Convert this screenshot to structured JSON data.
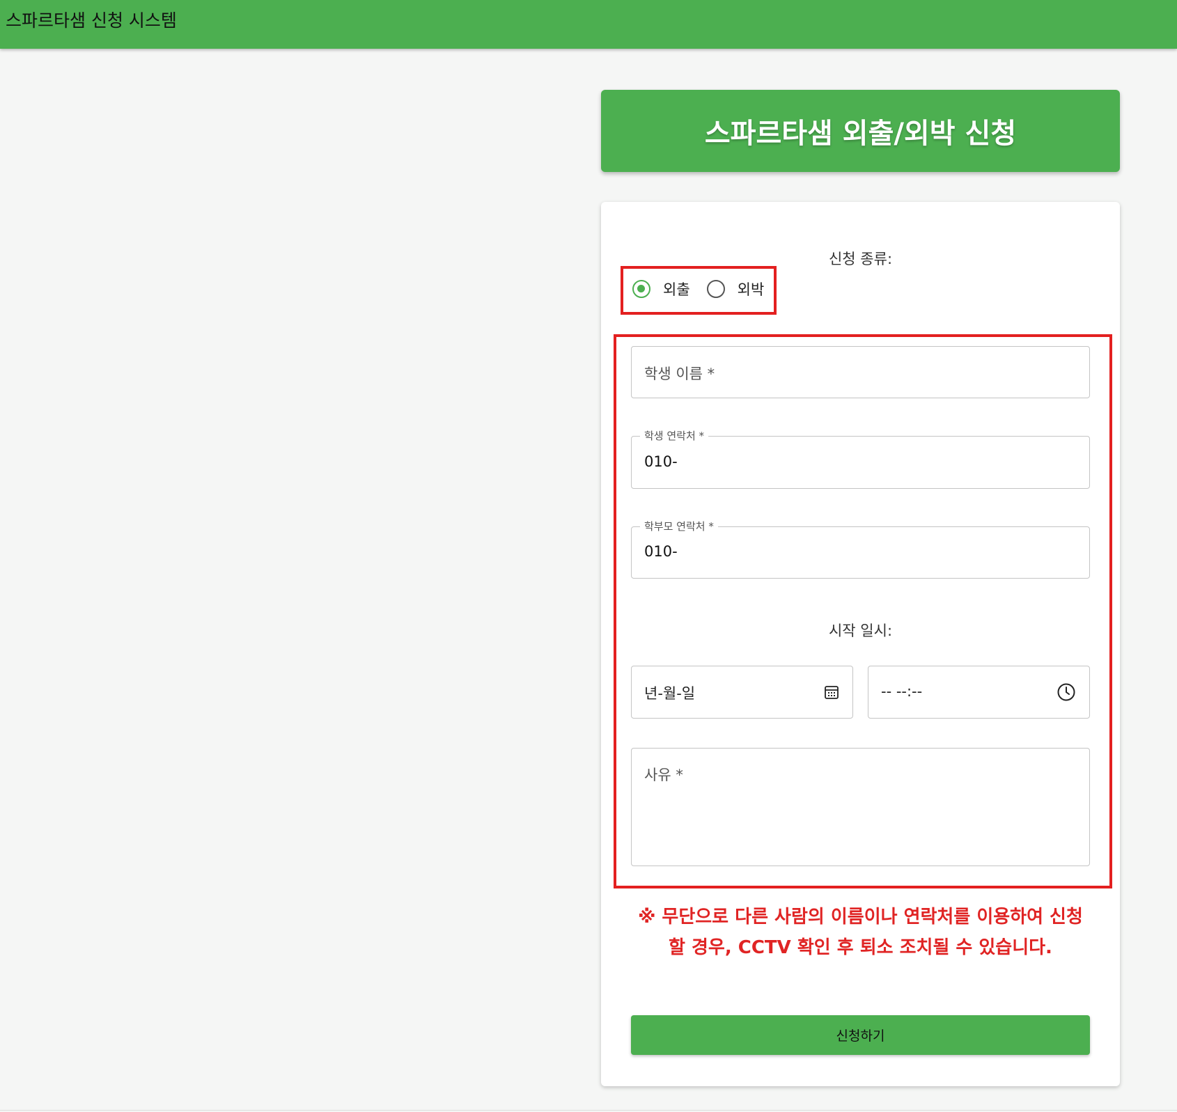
{
  "header": {
    "title": "스파르타샘 신청 시스템"
  },
  "form": {
    "heading": "스파르타샘 외출/외박 신청",
    "type_label": "신청 종류:",
    "type_options": [
      {
        "label": "외출",
        "checked": true
      },
      {
        "label": "외박",
        "checked": false
      }
    ],
    "student_name": {
      "placeholder": "학생 이름 *"
    },
    "student_phone": {
      "label": "학생 연락처 *",
      "value": "010-"
    },
    "parent_phone": {
      "label": "학부모 연락처 *",
      "value": "010-"
    },
    "start_label": "시작 일시:",
    "date_input": {
      "placeholder": "년-월-일",
      "icon": "calendar-icon"
    },
    "time_input": {
      "placeholder": "-- --:--",
      "icon": "clock-icon"
    },
    "reason": {
      "placeholder": "사유 *"
    },
    "warning_line1": "※ 무단으로 다른 사람의 이름이나 연락처를 이용하여 신청",
    "warning_line2": "할 경우, CCTV 확인 후 퇴소 조치될 수 있습니다.",
    "submit_label": "신청하기"
  },
  "colors": {
    "primary": "#4caf50",
    "highlight": "#e32020",
    "warning": "#e02424",
    "background": "#f5f6f5"
  }
}
